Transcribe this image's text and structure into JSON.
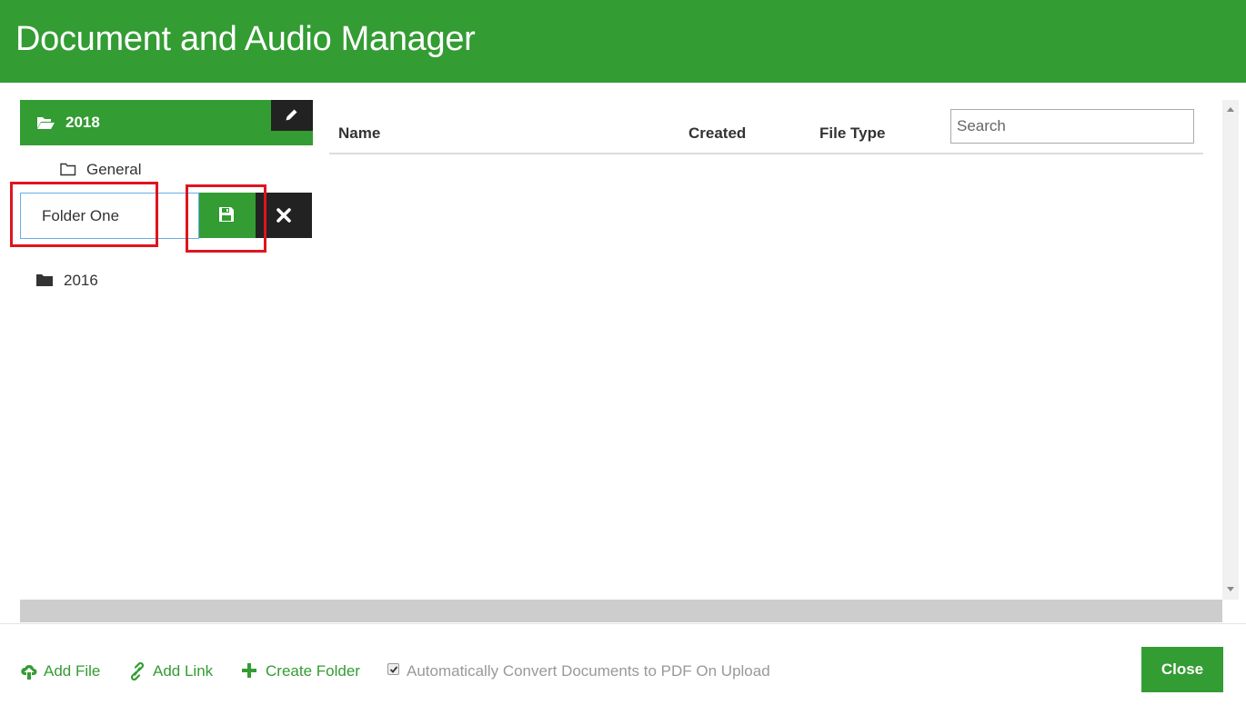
{
  "header": {
    "title": "Document and Audio Manager"
  },
  "sidebar": {
    "folders": [
      {
        "label": "2018",
        "state": "open",
        "selected": true
      },
      {
        "label": "General",
        "state": "closed"
      },
      {
        "label": "2016",
        "state": "closed-solid"
      }
    ],
    "new_folder": {
      "value": "Folder One"
    }
  },
  "table": {
    "columns": [
      "Name",
      "Created",
      "File Type"
    ],
    "search_placeholder": "Search",
    "rows": []
  },
  "footer": {
    "add_file": "Add File",
    "add_link": "Add Link",
    "create_folder": "Create Folder",
    "auto_convert": {
      "label": "Automatically Convert Documents to PDF On Upload",
      "checked": true
    },
    "close": "Close"
  },
  "colors": {
    "brand": "#339c33",
    "dark": "#222222",
    "highlight": "#e0141e"
  },
  "icons": [
    "folder-open-icon",
    "pencil-icon",
    "folder-icon",
    "save-icon",
    "close-icon",
    "folder-solid-icon",
    "cloud-upload-icon",
    "link-icon",
    "plus-icon",
    "checkbox-icon"
  ]
}
